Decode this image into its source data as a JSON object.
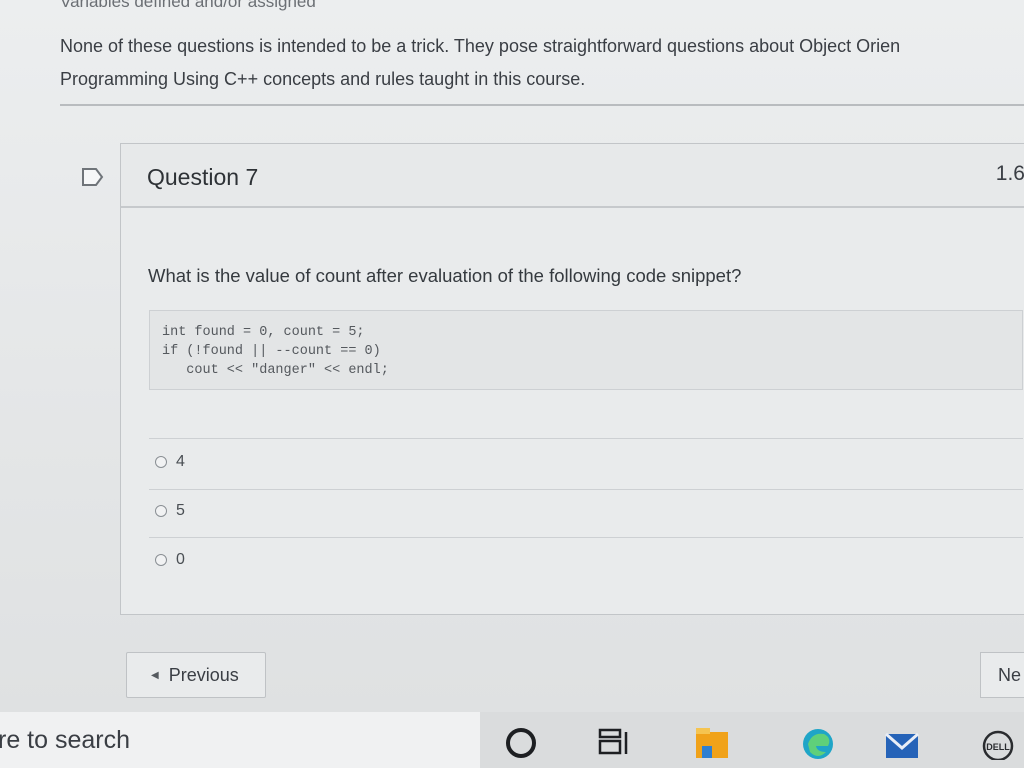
{
  "page": {
    "top_cut_text": "Variables defined and/or assigned",
    "intro_line1": "None of these questions is intended to be a trick. They pose straightforward questions about Object Orien",
    "intro_line2": "Programming Using C++ concepts and rules taught in this course."
  },
  "question": {
    "title": "Question 7",
    "points": "1.6",
    "prompt": "What is the value of count after evaluation of the following code snippet?",
    "code_lines": [
      "int found = 0, count = 5;",
      "if (!found || --count == 0)",
      "   cout << \"danger\" << endl;"
    ],
    "answers": [
      {
        "label": "4"
      },
      {
        "label": "5"
      },
      {
        "label": "0"
      }
    ]
  },
  "nav": {
    "previous_label": "Previous",
    "next_label": "Ne"
  },
  "taskbar": {
    "search_text": "re to search",
    "icons": [
      "cortana-circle-icon",
      "task-view-icon",
      "file-explorer-icon",
      "edge-icon",
      "mail-icon",
      "dell-icon"
    ]
  },
  "colors": {
    "accent_orange": "#f0a21a",
    "edge_teal": "#1fa5c7",
    "mail_blue": "#2563b8"
  }
}
